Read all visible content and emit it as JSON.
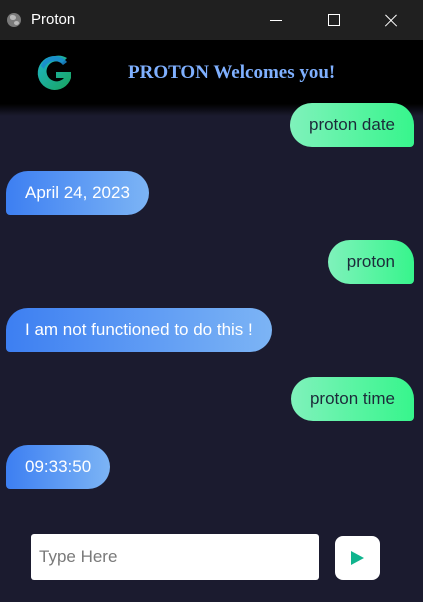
{
  "window": {
    "title": "Proton",
    "icon": "globe-icon",
    "controls": [
      "minimize-icon",
      "maximize-icon",
      "close-icon"
    ]
  },
  "header": {
    "logo": "g-logo-icon",
    "title": "PROTON Welcomes you!",
    "title_color": "#7fb0ff"
  },
  "messages": [
    {
      "sender": "user",
      "text": "proton date"
    },
    {
      "sender": "bot",
      "text": "April 24, 2023"
    },
    {
      "sender": "user",
      "text": "proton"
    },
    {
      "sender": "bot",
      "text": "I am not functioned to do this !"
    },
    {
      "sender": "user",
      "text": "proton time"
    },
    {
      "sender": "bot",
      "text": "09:33:50"
    }
  ],
  "composer": {
    "placeholder": "Type Here",
    "value": "",
    "send_icon": "send-play-icon"
  },
  "colors": {
    "chat_background": "#1b1b2f",
    "user_bubble": "#37f58c",
    "bot_bubble": "#3d7ff2",
    "send_accent": "#10b48e"
  }
}
